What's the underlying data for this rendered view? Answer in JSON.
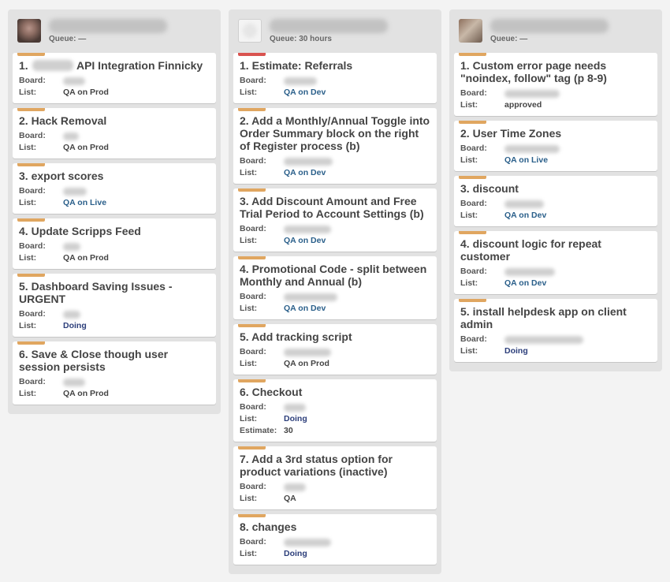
{
  "columns": [
    {
      "queue": "Queue: —",
      "cards": [
        {
          "num": "1.",
          "title": "API Integration Finnicky",
          "board_label": "Board:",
          "list_label": "List:",
          "list": "QA on Prod"
        },
        {
          "num": "2.",
          "title": "Hack Removal",
          "board_label": "Board:",
          "list_label": "List:",
          "list": "QA on Prod"
        },
        {
          "num": "3.",
          "title": "export scores",
          "board_label": "Board:",
          "list_label": "List:",
          "list": "QA on Live"
        },
        {
          "num": "4.",
          "title": "Update Scripps Feed",
          "board_label": "Board:",
          "list_label": "List:",
          "list": "QA on Prod"
        },
        {
          "num": "5.",
          "title": "Dashboard Saving Issues -\nURGENT",
          "board_label": "Board:",
          "list_label": "List:",
          "list": "Doing"
        },
        {
          "num": "6.",
          "title": "Save & Close though user\nsession persists",
          "board_label": "Board:",
          "list_label": "List:",
          "list": "QA on Prod"
        }
      ]
    },
    {
      "queue": "Queue: 30 hours",
      "cards": [
        {
          "num": "1.",
          "title": "Estimate: Referrals",
          "board_label": "Board:",
          "list_label": "List:",
          "list": "QA on Dev"
        },
        {
          "num": "2.",
          "title": "Add a Monthly/Annual Toggle into\nOrder Summary block on the right\nof Register process (b)",
          "board_label": "Board:",
          "list_label": "List:",
          "list": "QA on Dev"
        },
        {
          "num": "3.",
          "title": "Add Discount Amount and Free\nTrial Period to Account Settings (b)",
          "board_label": "Board:",
          "list_label": "List:",
          "list": "QA on Dev"
        },
        {
          "num": "4.",
          "title": "Promotional Code - split between\nMonthly and Annual (b)",
          "board_label": "Board:",
          "list_label": "List:",
          "list": "QA on Dev"
        },
        {
          "num": "5.",
          "title": "Add tracking script",
          "board_label": "Board:",
          "list_label": "List:",
          "list": "QA on Prod"
        },
        {
          "num": "6.",
          "title": "Checkout",
          "board_label": "Board:",
          "list_label": "List:",
          "list": "Doing",
          "estimate_label": "Estimate:",
          "estimate": "30"
        },
        {
          "num": "7.",
          "title": "Add a 3rd status option for\nproduct variations (inactive)",
          "board_label": "Board:",
          "list_label": "List:",
          "list": "QA"
        },
        {
          "num": "8.",
          "title": "changes",
          "board_label": "Board:",
          "list_label": "List:",
          "list": "Doing"
        }
      ]
    },
    {
      "queue": "Queue: —",
      "cards": [
        {
          "num": "1.",
          "title": "Custom error page needs\n\"noindex, follow\" tag (p 8-9)",
          "board_label": "Board:",
          "list_label": "List:",
          "list": "approved"
        },
        {
          "num": "2.",
          "title": "User Time Zones",
          "board_label": "Board:",
          "list_label": "List:",
          "list": "QA on Live"
        },
        {
          "num": "3.",
          "title": "discount",
          "board_label": "Board:",
          "list_label": "List:",
          "list": "QA on Dev"
        },
        {
          "num": "4.",
          "title": "discount logic for repeat\ncustomer",
          "board_label": "Board:",
          "list_label": "List:",
          "list": "QA on Dev"
        },
        {
          "num": "5.",
          "title": "install helpdesk app on client\nadmin",
          "board_label": "Board:",
          "list_label": "List:",
          "list": "Doing"
        }
      ]
    }
  ],
  "colors": {
    "label_orange": "#e0a660",
    "label_red": "#d9534f",
    "link_blue": "#2a5f8a"
  }
}
